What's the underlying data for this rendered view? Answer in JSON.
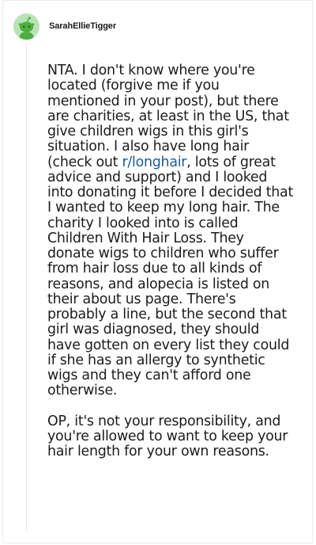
{
  "comment": {
    "username": "SarahEllieTigger",
    "avatar_icon": "snoo-avatar-icon",
    "paragraph1": {
      "before_link": "NTA. I don't know where you're located (forgive me if you mentioned in your post), but there are charities, at least in the US, that give children wigs in this girl's situation. I also have long hair (check out ",
      "link_text": "r/longhair",
      "after_link": ", lots of great advice and support) and I looked into donating it before I decided that I wanted to keep my long hair. The charity I looked into is called Children With Hair Loss. They donate wigs to children who suffer from hair loss due to all kinds of reasons, and alopecia is listed on their about us page. There's probably a line, but the second that girl was diagnosed, they should have gotten on every list they could if she has an allergy to synthetic wigs and they can't afford one otherwise."
    },
    "paragraph2": "OP, it's not your responsibility, and you're allowed to want to keep your hair length for your own reasons."
  },
  "colors": {
    "link": "#1a5a96",
    "avatar_bg": "#b9e3b7",
    "avatar_figure": "#4caf3f"
  }
}
